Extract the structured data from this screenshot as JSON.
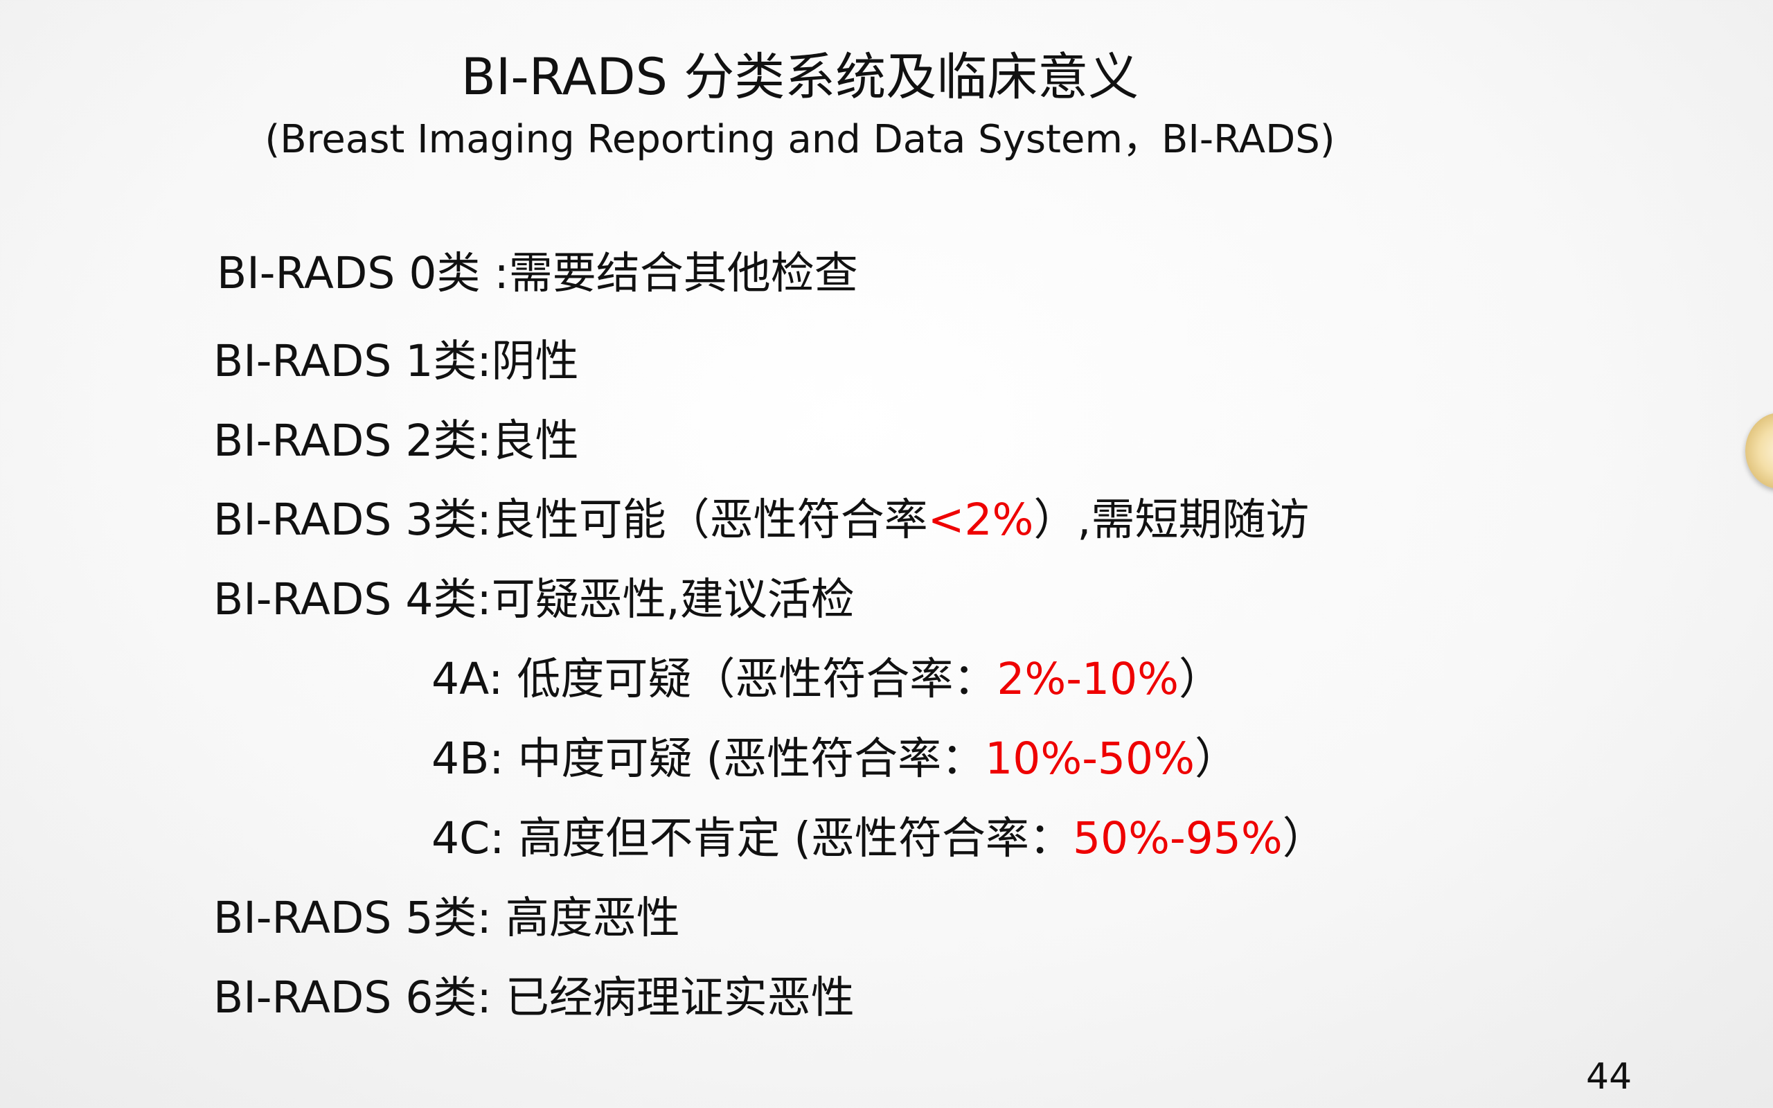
{
  "slide": {
    "title": "BI-RADS 分类系统及临床意义",
    "subtitle": "(Breast Imaging Reporting and Data System，BI-RADS)",
    "items": {
      "c0": {
        "text": "BI-RADS 0类 :需要结合其他检查"
      },
      "c1": {
        "text": "BI-RADS 1类:阴性"
      },
      "c2": {
        "text": "BI-RADS 2类:良性"
      },
      "c3": {
        "prefix": "BI-RADS 3类:良性可能（恶性符合率",
        "highlight": "<2%",
        "suffix": "）,需短期随访"
      },
      "c4": {
        "text": "BI-RADS 4类:可疑恶性,建议活检"
      },
      "c4a": {
        "prefix": "4A: 低度可疑（恶性符合率：",
        "highlight": "2%-10%",
        "suffix": "）"
      },
      "c4b": {
        "prefix": "4B: 中度可疑 (恶性符合率：",
        "highlight": "10%-50%",
        "suffix": "）"
      },
      "c4c": {
        "prefix": "4C: 高度但不肯定 (恶性符合率：",
        "highlight": "50%-95%",
        "suffix": "）"
      },
      "c5": {
        "text": "BI-RADS 5类: 高度恶性"
      },
      "c6": {
        "text": "BI-RADS 6类: 已经病理证实恶性"
      }
    },
    "page_number": "44"
  },
  "colors": {
    "text": "#111111",
    "highlight": "#ee0000",
    "handle": "#f4dfa8"
  }
}
